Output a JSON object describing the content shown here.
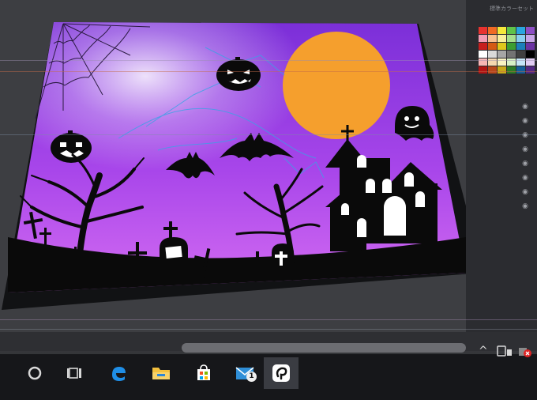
{
  "panel": {
    "title": "標準カラーセット",
    "swatches": [
      "#e8322f",
      "#f06a24",
      "#f6e83b",
      "#5fc34a",
      "#2aa6df",
      "#8d4fc4",
      "#f39cb4",
      "#f8c18f",
      "#fbf09a",
      "#a7e08d",
      "#8ad0f0",
      "#c7a4e6",
      "#c71e1e",
      "#d45a14",
      "#e0c81c",
      "#3c9e31",
      "#1c7fba",
      "#6c33a3",
      "#ffffff",
      "#d9d9d9",
      "#a6a6a6",
      "#737373",
      "#404040",
      "#000000",
      "#f7b6b6",
      "#f5d7b0",
      "#f9f3c2",
      "#d6f0c4",
      "#c5e6f7",
      "#e1cdf3",
      "#b11414",
      "#b8471b",
      "#c9a81a",
      "#2c7c25",
      "#145f9a",
      "#532883"
    ]
  },
  "illustration": {
    "sky_top": "#7b2fd8",
    "sky_bottom": "#d46cf2",
    "moon_color": "#f59f2d",
    "silhouette_color": "#0a0a0a"
  },
  "taskbar": {
    "items": [
      {
        "name": "cortana-icon"
      },
      {
        "name": "task-view-icon"
      },
      {
        "name": "edge-icon"
      },
      {
        "name": "file-explorer-icon"
      },
      {
        "name": "store-icon"
      },
      {
        "name": "mail-icon"
      },
      {
        "name": "clip-studio-icon"
      }
    ],
    "mail_badge": "1",
    "tray_chevron": "^"
  }
}
